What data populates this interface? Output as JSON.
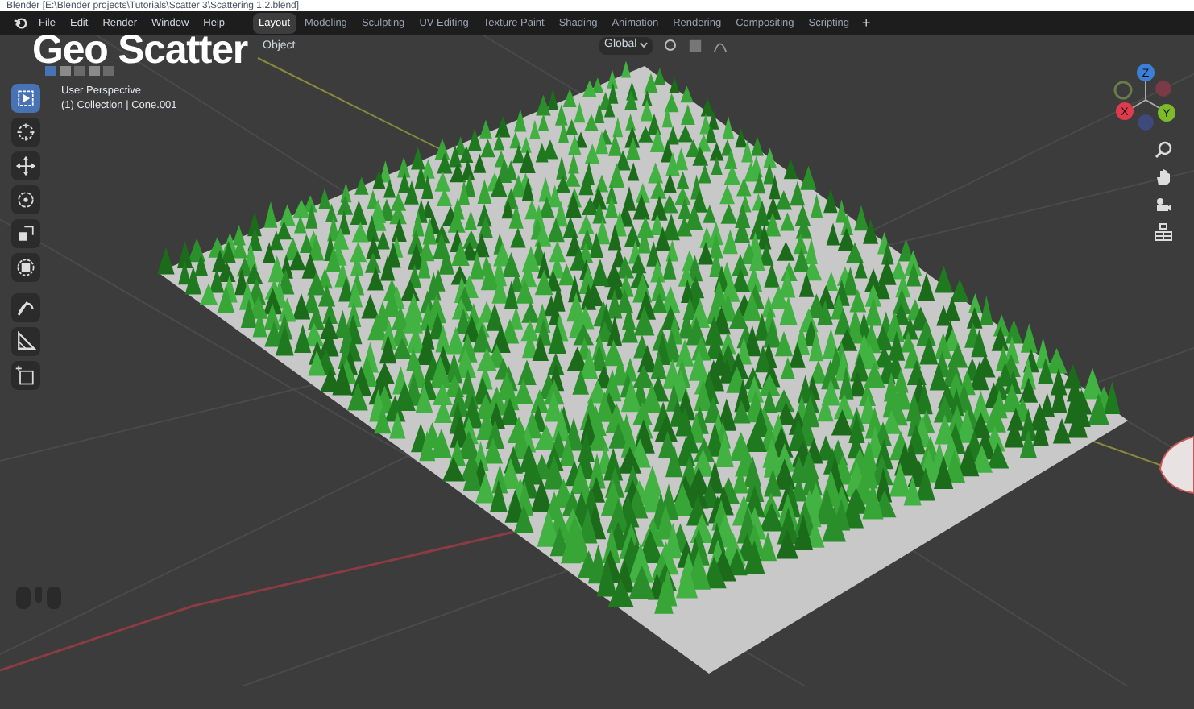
{
  "window": {
    "title": "Blender [E:\\Blender projects\\Tutorials\\Scatter 3\\Scattering 1.2.blend]"
  },
  "menu": [
    "File",
    "Edit",
    "Render",
    "Window",
    "Help"
  ],
  "workspaces": [
    {
      "label": "Layout",
      "selected": true
    },
    {
      "label": "Modeling",
      "selected": false
    },
    {
      "label": "Sculpting",
      "selected": false
    },
    {
      "label": "UV Editing",
      "selected": false
    },
    {
      "label": "Texture Paint",
      "selected": false
    },
    {
      "label": "Shading",
      "selected": false
    },
    {
      "label": "Animation",
      "selected": false
    },
    {
      "label": "Rendering",
      "selected": false
    },
    {
      "label": "Compositing",
      "selected": false
    },
    {
      "label": "Scripting",
      "selected": false
    }
  ],
  "add_workspace": "+",
  "header": {
    "mode": "Object",
    "orientation": "Global"
  },
  "overlay_title": "Geo Scatter",
  "viewport": {
    "view_name": "User Perspective",
    "collection": "(1) Collection | Cone.001"
  },
  "tools": [
    {
      "kind": "select",
      "selected": true
    },
    {
      "kind": "cursor",
      "selected": false
    },
    {
      "kind": "move",
      "selected": false
    },
    {
      "kind": "rotate",
      "selected": false
    },
    {
      "kind": "scale",
      "selected": false
    },
    {
      "kind": "transform",
      "selected": false
    },
    {
      "kind": "annotate",
      "selected": false
    },
    {
      "kind": "measure",
      "selected": false
    },
    {
      "kind": "add",
      "selected": false
    }
  ],
  "gizmo": {
    "x": "X",
    "y": "Y",
    "z": "Z"
  }
}
